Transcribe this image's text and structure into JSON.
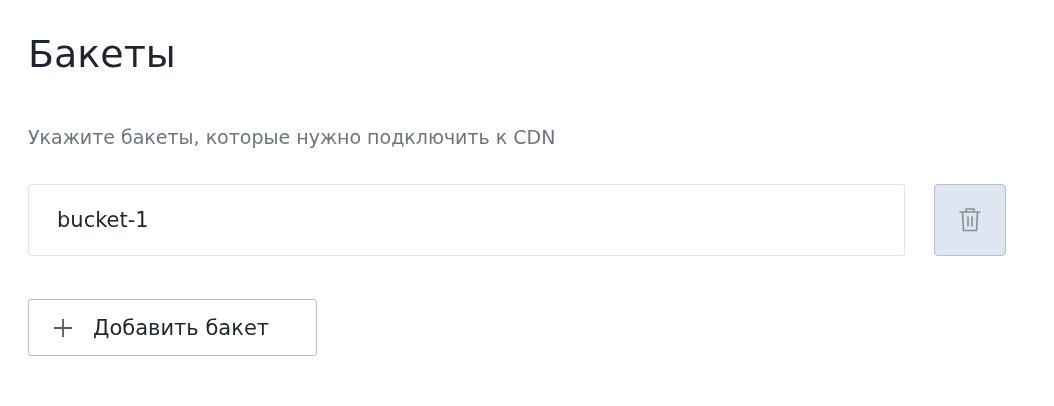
{
  "title": "Бакеты",
  "description": "Укажите бакеты, которые нужно подключить к CDN",
  "buckets": [
    {
      "value": "bucket-1",
      "delete_disabled": true
    }
  ],
  "add_button": {
    "label": "Добавить бакет"
  }
}
